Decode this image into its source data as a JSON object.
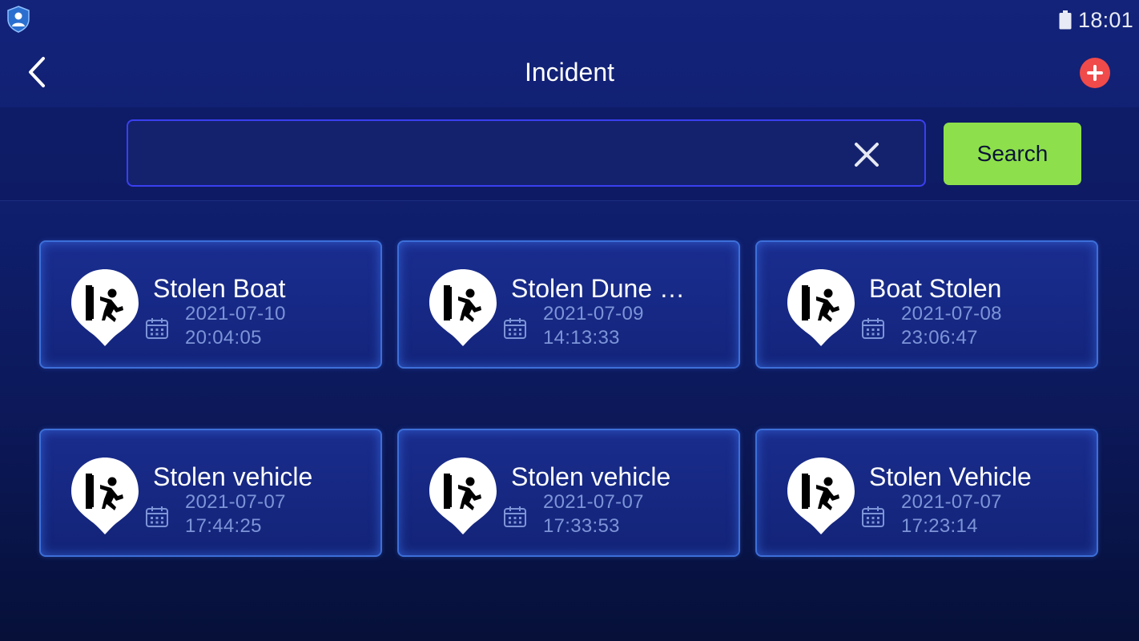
{
  "status_bar": {
    "time": "18:01",
    "app_icon": "shield-person-icon",
    "battery_icon": "battery-icon"
  },
  "header": {
    "title": "Incident",
    "back_icon": "chevron-left-icon",
    "add_icon": "plus-circle-icon"
  },
  "search": {
    "value": "",
    "clear_icon": "close-icon",
    "button_label": "Search"
  },
  "colors": {
    "accent_green": "#8de04b",
    "add_red": "#f04a4a",
    "card_border": "#3d6fd8",
    "date_text": "#7d94d8"
  },
  "incidents": [
    {
      "title": "Stolen Boat",
      "date": "2021-07-10",
      "time": "20:04:05",
      "icon": "theft-pin-icon"
    },
    {
      "title": "Stolen Dune …",
      "date": "2021-07-09",
      "time": "14:13:33",
      "icon": "theft-pin-icon"
    },
    {
      "title": "Boat Stolen",
      "date": "2021-07-08",
      "time": "23:06:47",
      "icon": "theft-pin-icon"
    },
    {
      "title": "Stolen vehicle",
      "date": "2021-07-07",
      "time": "17:44:25",
      "icon": "theft-pin-icon"
    },
    {
      "title": "Stolen vehicle",
      "date": "2021-07-07",
      "time": "17:33:53",
      "icon": "theft-pin-icon"
    },
    {
      "title": "Stolen Vehicle",
      "date": "2021-07-07",
      "time": "17:23:14",
      "icon": "theft-pin-icon"
    }
  ]
}
